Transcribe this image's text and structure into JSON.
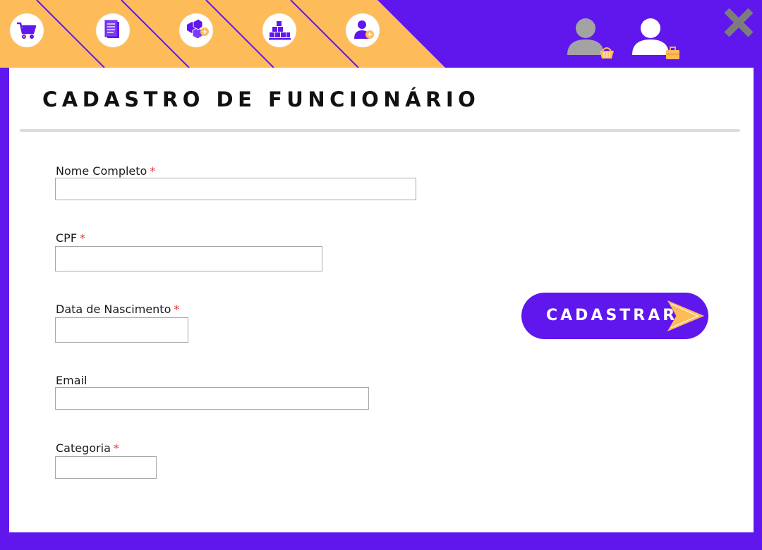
{
  "header": {
    "nav_icons": [
      {
        "name": "shopping-cart-icon"
      },
      {
        "name": "document-icon"
      },
      {
        "name": "add-boxes-icon"
      },
      {
        "name": "inventory-pallet-icon"
      },
      {
        "name": "add-user-icon"
      }
    ],
    "user_icons": [
      {
        "name": "customer-basket-icon"
      },
      {
        "name": "employee-briefcase-icon"
      }
    ],
    "close_icon": "close-icon"
  },
  "form": {
    "title": "CADASTRO DE FUNCIONÁRIO",
    "fields": [
      {
        "label": "Nome Completo",
        "required": "*",
        "value": "",
        "placeholder": ""
      },
      {
        "label": "CPF",
        "required": "*",
        "value": "",
        "placeholder": ""
      },
      {
        "label": "Data de Nascimento",
        "required": "*",
        "value": "",
        "placeholder": ""
      },
      {
        "label": "Email",
        "required": "",
        "value": "",
        "placeholder": ""
      },
      {
        "label": "Categoria",
        "required": "*",
        "value": "",
        "placeholder": ""
      }
    ],
    "submit_label": "CADASTRAR"
  },
  "colors": {
    "brand_purple": "#5f17ee",
    "accent_orange": "#fdbb5a",
    "required_red": "#e53935",
    "inactive_gray": "#a3a3a3"
  }
}
